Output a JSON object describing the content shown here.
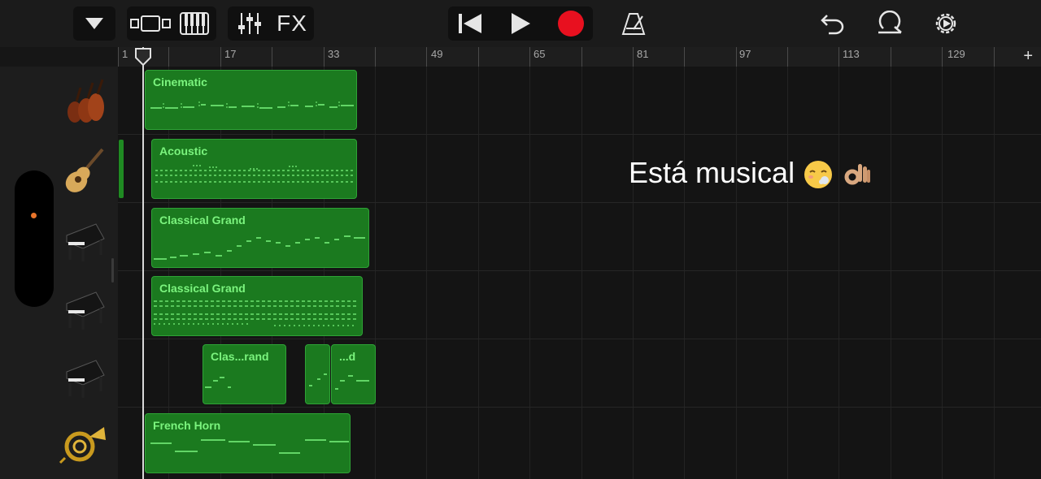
{
  "toolbar": {
    "fx_label": "FX"
  },
  "ruler": {
    "labels": [
      "1",
      "17",
      "33",
      "49",
      "65",
      "81",
      "97",
      "113",
      "129"
    ],
    "add_label": "+"
  },
  "tracks": [
    {
      "instrument": "strings-icon"
    },
    {
      "instrument": "acoustic-guitar-icon"
    },
    {
      "instrument": "grand-piano-icon"
    },
    {
      "instrument": "grand-piano-icon"
    },
    {
      "instrument": "grand-piano-icon"
    },
    {
      "instrument": "french-horn-icon"
    }
  ],
  "regions": {
    "cinematic": "Cinematic",
    "acoustic": "Acoustic",
    "classical1": "Classical Grand",
    "classical2": "Classical Grand",
    "classical3a": "Clas...rand",
    "classical3c": "...d",
    "horn": "French Horn"
  },
  "overlay": {
    "text": "Está musical"
  },
  "colors": {
    "region_fill": "#1b7a1f",
    "region_label": "#7bf47e",
    "record": "#e8101f"
  }
}
